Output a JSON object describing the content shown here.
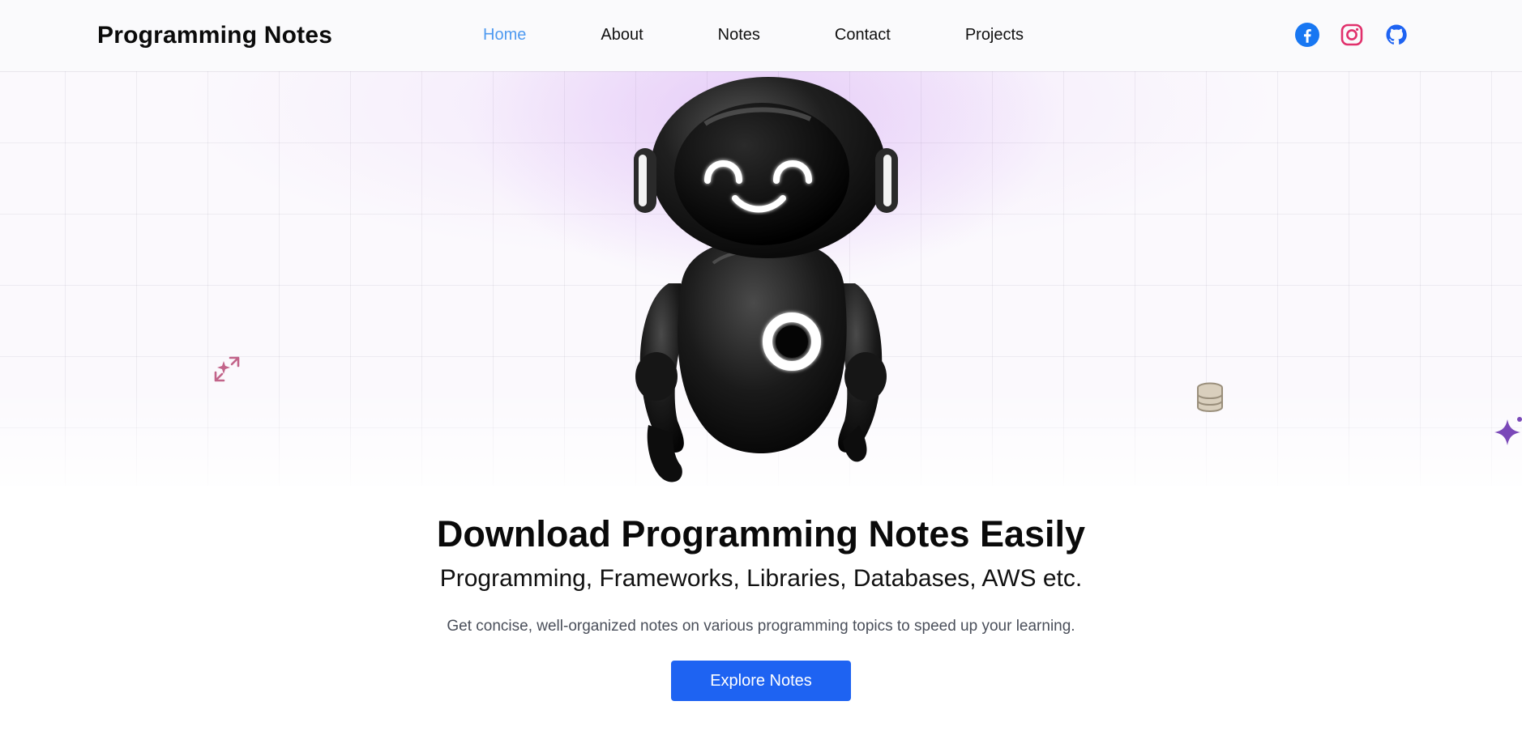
{
  "header": {
    "brand": "Programming Notes",
    "nav": [
      {
        "label": "Home",
        "active": true
      },
      {
        "label": "About",
        "active": false
      },
      {
        "label": "Notes",
        "active": false
      },
      {
        "label": "Contact",
        "active": false
      },
      {
        "label": "Projects",
        "active": false
      }
    ],
    "socials": [
      {
        "icon": "facebook-icon",
        "color": "#1877f2"
      },
      {
        "icon": "instagram-icon",
        "color": "#e1306c"
      },
      {
        "icon": "github-icon",
        "color": "#1e63f2"
      }
    ]
  },
  "hero": {
    "illustration": "robot-mascot",
    "decorations": [
      "sparkle-arrows-icon",
      "database-icon",
      "sparkle-icon"
    ]
  },
  "main": {
    "title": "Download Programming Notes Easily",
    "subtitle": "Programming, Frameworks, Libraries, Databases, AWS etc.",
    "description": "Get concise, well-organized notes on various programming topics to speed up your learning.",
    "cta_label": "Explore Notes"
  },
  "colors": {
    "accent": "#1e63f2",
    "nav_active": "#4f9af0"
  }
}
